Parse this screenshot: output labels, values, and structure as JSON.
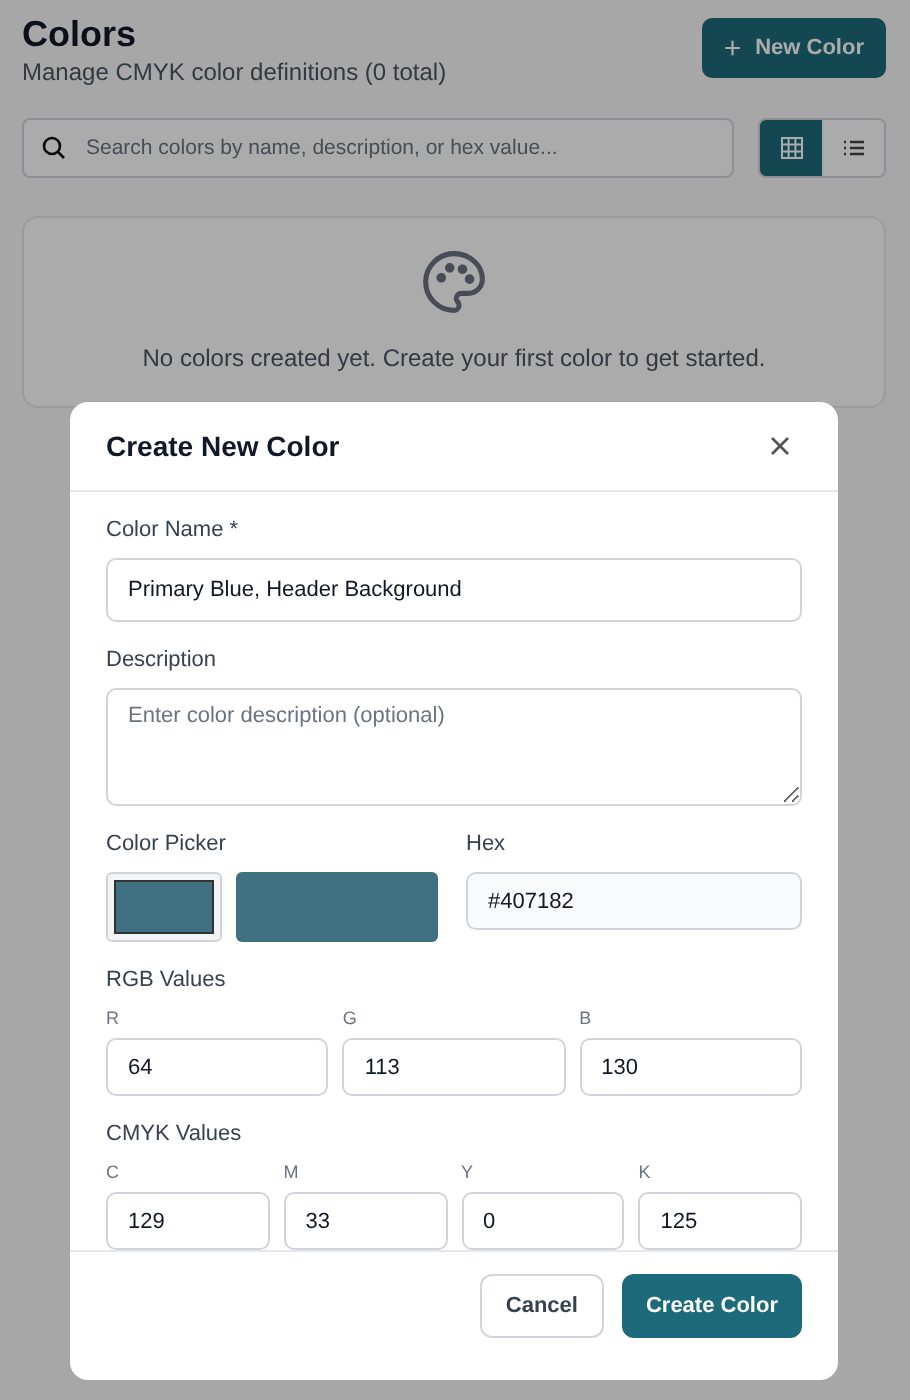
{
  "header": {
    "title": "Colors",
    "subtitle": "Manage CMYK color definitions (0 total)",
    "new_button": {
      "icon": "+",
      "label": "New Color"
    }
  },
  "search": {
    "placeholder": "Search colors by name, description, or hex value..."
  },
  "view_toggle": [
    {
      "kind": "grid",
      "selected": true
    },
    {
      "kind": "list",
      "selected": false
    }
  ],
  "empty_state": {
    "message": "No colors created yet. Create your first color to get started."
  },
  "modal": {
    "title": "Create New Color",
    "name_field": {
      "label": "Color Name *",
      "value": "Primary Blue, Header Background"
    },
    "description_field": {
      "label": "Description",
      "placeholder": "Enter color description (optional)"
    },
    "picker": {
      "label": "Color Picker"
    },
    "hex": {
      "label": "Hex",
      "value": "#407182"
    },
    "rgb": {
      "label": "RGB Values",
      "fields": [
        {
          "label": "R",
          "value": "64"
        },
        {
          "label": "G",
          "value": "113"
        },
        {
          "label": "B",
          "value": "130"
        }
      ]
    },
    "cmyk": {
      "label": "CMYK Values",
      "fields": [
        {
          "label": "C",
          "value": "129"
        },
        {
          "label": "M",
          "value": "33"
        },
        {
          "label": "Y",
          "value": "0"
        },
        {
          "label": "K",
          "value": "125"
        }
      ]
    },
    "buttons": {
      "cancel": "Cancel",
      "submit": "Create Color"
    }
  }
}
